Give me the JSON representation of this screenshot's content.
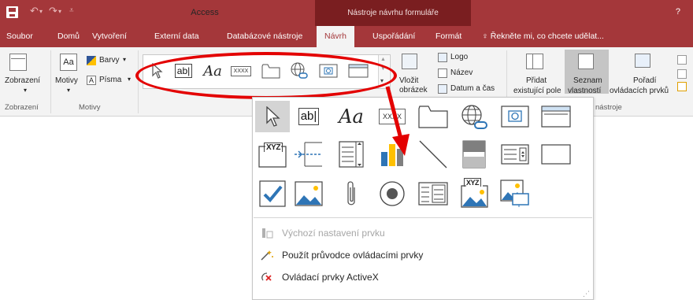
{
  "title_bar": {
    "app_title": "Access",
    "context_tools": "Nástroje návrhu formuláře",
    "help": "?"
  },
  "tabs": [
    {
      "label": "Soubor"
    },
    {
      "label": "Domů"
    },
    {
      "label": "Vytvoření"
    },
    {
      "label": "Externí data"
    },
    {
      "label": "Databázové nástroje"
    },
    {
      "label": "Návrh",
      "active": true
    },
    {
      "label": "Uspořádání"
    },
    {
      "label": "Formát"
    }
  ],
  "tell_me": "Řekněte mi, co chcete udělat...",
  "ribbon": {
    "view_label": "Zobrazení",
    "themes_label": "Motivy",
    "colors_label": "Barvy",
    "fonts_label": "Písma",
    "insert_image_label1": "Vložit",
    "insert_image_label2": "obrázek",
    "logo_label": "Logo",
    "title_label": "Název",
    "datetime_label": "Datum a čas",
    "add_existing_label1": "Přidat",
    "add_existing_label2": "existující pole",
    "property_sheet_label1": "Seznam",
    "property_sheet_label2": "vlastností",
    "tab_order_label1": "Pořadí",
    "tab_order_label2": "ovládacích prvků",
    "groups": {
      "views": "Zobrazení",
      "themes": "Motivy",
      "tools": "nástroje"
    }
  },
  "gallery_cells": [
    "select-pointer",
    "textbox",
    "label",
    "button",
    "tab-control",
    "hyperlink",
    "web-browser",
    "navigation"
  ],
  "dropdown": {
    "label_text": "Aa",
    "textbox_text": "ab|",
    "button_text": "XXXX",
    "option_group_text": "XYZ",
    "menu": [
      {
        "label": "Výchozí nastavení prvku",
        "disabled": true
      },
      {
        "label": "Použít průvodce ovládacími prvky",
        "disabled": false
      },
      {
        "label": "Ovládací prvky ActiveX",
        "disabled": false
      }
    ]
  },
  "colors": {
    "accent": "#a4373a",
    "highlight": "#e30000"
  }
}
